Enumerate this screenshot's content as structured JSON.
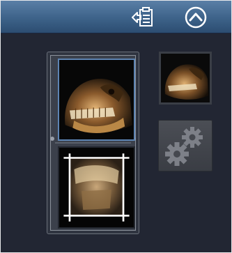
{
  "header": {
    "icons": [
      "report-export-icon",
      "collapse-up-icon"
    ]
  },
  "thumbnails": [
    {
      "name": "3d-skull-render",
      "selected": true
    },
    {
      "name": "cropped-volume-view",
      "selected": false
    }
  ],
  "side": {
    "preview_icon": "3d-skull-preview-icon",
    "settings_icon": "gears-icon"
  },
  "colors": {
    "header": "#3d6289",
    "background": "#222633",
    "selection": "#5d84b3",
    "crop_frame": "#ffffff"
  }
}
